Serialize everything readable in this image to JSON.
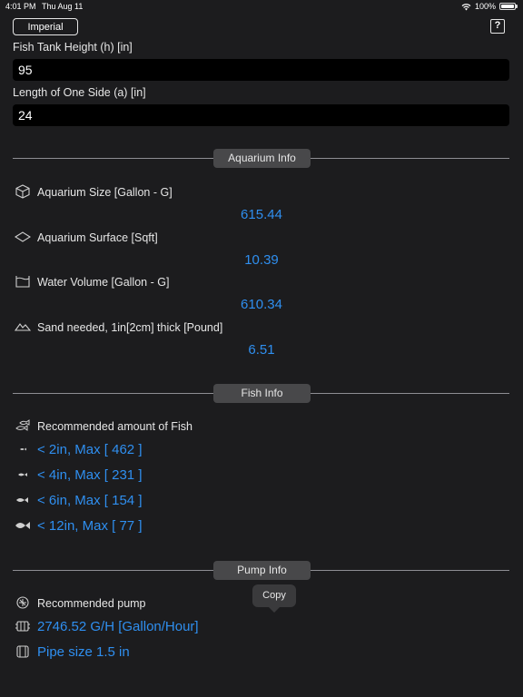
{
  "status": {
    "time": "4:01 PM",
    "date": "Thu Aug 11",
    "battery": "100%"
  },
  "header": {
    "unit_label": "Imperial",
    "help_label": "?"
  },
  "inputs": {
    "height": {
      "label": "Fish Tank Height (h) [in]",
      "value": "95"
    },
    "side": {
      "label": "Length of One Side (a) [in]",
      "value": "24"
    }
  },
  "aquarium": {
    "title": "Aquarium Info",
    "items": [
      {
        "label": "Aquarium Size [Gallon - G]",
        "value": "615.44",
        "icon": "cube-icon"
      },
      {
        "label": "Aquarium Surface [Sqft]",
        "value": "10.39",
        "icon": "diamond-icon"
      },
      {
        "label": "Water Volume [Gallon - G]",
        "value": "610.34",
        "icon": "tank-icon"
      },
      {
        "label": "Sand needed, 1in[2cm] thick [Pound]",
        "value": "6.51",
        "icon": "sand-icon"
      }
    ]
  },
  "fish": {
    "title": "Fish Info",
    "heading": "Recommended amount of Fish",
    "rows": [
      {
        "text": "< 2in, Max [ 462 ]"
      },
      {
        "text": "< 4in, Max [ 231 ]"
      },
      {
        "text": "< 6in, Max [ 154 ]"
      },
      {
        "text": "< 12in, Max [ 77 ]"
      }
    ]
  },
  "pump": {
    "title": "Pump Info",
    "heading": "Recommended pump",
    "flow": "2746.52 G/H [Gallon/Hour]",
    "pipe": "Pipe size 1.5 in"
  },
  "tooltip": {
    "copy": "Copy"
  }
}
